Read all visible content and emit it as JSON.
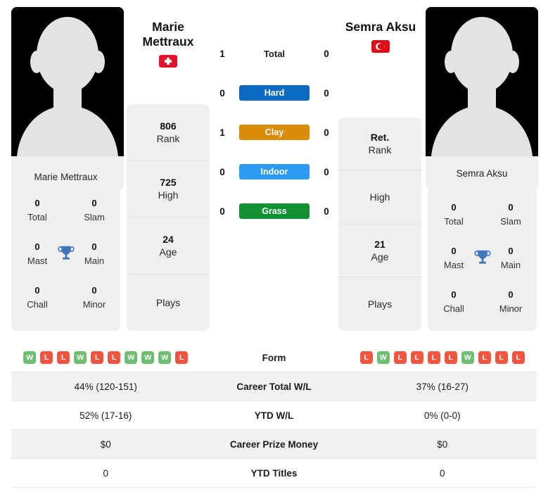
{
  "players": {
    "left": {
      "name": "Marie Mettraux",
      "display_name_line1": "Marie",
      "display_name_line2": "Mettraux",
      "country": "Switzerland",
      "flag_icon": "flag-switzerland-icon",
      "avatar_icon": "player-avatar-placeholder-icon",
      "rank": "806",
      "rank_label": "Rank",
      "high": "725",
      "high_label": "High",
      "age": "24",
      "age_label": "Age",
      "plays": "",
      "plays_label": "Plays",
      "titles": {
        "total": "0",
        "total_label": "Total",
        "slam": "0",
        "slam_label": "Slam",
        "mast": "0",
        "mast_label": "Mast",
        "main": "0",
        "main_label": "Main",
        "chall": "0",
        "chall_label": "Chall",
        "minor": "0",
        "minor_label": "Minor"
      },
      "form": [
        "W",
        "L",
        "L",
        "W",
        "L",
        "L",
        "W",
        "W",
        "W",
        "L"
      ],
      "career_total_wl": "44% (120-151)",
      "ytd_wl": "52% (17-16)",
      "career_prize_money": "$0",
      "ytd_titles": "0"
    },
    "right": {
      "name": "Semra Aksu",
      "display_name_line1": "Semra Aksu",
      "display_name_line2": "",
      "country": "Turkey",
      "flag_icon": "flag-turkey-icon",
      "avatar_icon": "player-avatar-placeholder-icon",
      "rank": "Ret.",
      "rank_label": "Rank",
      "high": "",
      "high_label": "High",
      "age": "21",
      "age_label": "Age",
      "plays": "",
      "plays_label": "Plays",
      "titles": {
        "total": "0",
        "total_label": "Total",
        "slam": "0",
        "slam_label": "Slam",
        "mast": "0",
        "mast_label": "Mast",
        "main": "0",
        "main_label": "Main",
        "chall": "0",
        "chall_label": "Chall",
        "minor": "0",
        "minor_label": "Minor"
      },
      "form": [
        "L",
        "W",
        "L",
        "L",
        "L",
        "L",
        "W",
        "L",
        "L",
        "L"
      ],
      "career_total_wl": "37% (16-27)",
      "ytd_wl": "0% (0-0)",
      "career_prize_money": "$0",
      "ytd_titles": "0"
    }
  },
  "head_to_head": {
    "rows": [
      {
        "left": "1",
        "label": "Total",
        "right": "0",
        "style": "plain",
        "color": ""
      },
      {
        "left": "0",
        "label": "Hard",
        "right": "0",
        "style": "pill",
        "color": "#0b6bc3"
      },
      {
        "left": "1",
        "label": "Clay",
        "right": "0",
        "style": "pill",
        "color": "#d98c05"
      },
      {
        "left": "0",
        "label": "Indoor",
        "right": "0",
        "style": "pill",
        "color": "#2b9bf5"
      },
      {
        "left": "0",
        "label": "Grass",
        "right": "0",
        "style": "pill",
        "color": "#139234"
      }
    ]
  },
  "stats_table": {
    "rows": [
      {
        "label": "Form",
        "left": "",
        "right": "",
        "type": "form"
      },
      {
        "label": "Career Total W/L",
        "left": "44% (120-151)",
        "right": "37% (16-27)",
        "type": "text"
      },
      {
        "label": "YTD W/L",
        "left": "52% (17-16)",
        "right": "0% (0-0)",
        "type": "text"
      },
      {
        "label": "Career Prize Money",
        "left": "$0",
        "right": "$0",
        "type": "text"
      },
      {
        "label": "YTD Titles",
        "left": "0",
        "right": "0",
        "type": "text"
      }
    ]
  },
  "colors": {
    "hard": "#0b6bc3",
    "clay": "#d98c05",
    "indoor": "#2b9bf5",
    "grass": "#139234",
    "win_badge": "#6fbf73",
    "loss_badge": "#f1543f",
    "trophy": "#3f76bd",
    "card_bg": "#efefef",
    "row_alt_bg": "#f2f2f2"
  },
  "icons": {
    "trophy": "trophy-icon",
    "avatar": "person-silhouette-icon"
  }
}
